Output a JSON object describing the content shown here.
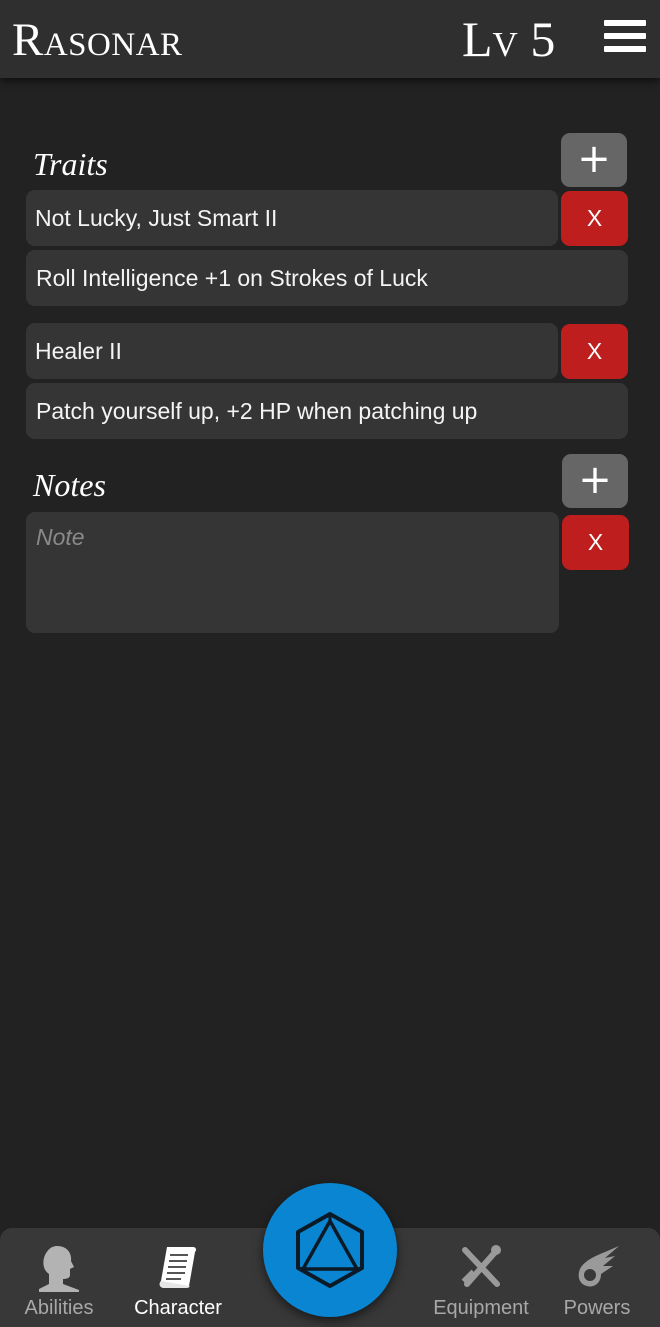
{
  "header": {
    "character_name": "Rasonar",
    "level": "Lv 5",
    "menu_icon": "hamburger-menu-icon"
  },
  "traits": {
    "title": "Traits",
    "add_label": "+",
    "items": [
      {
        "name": "Not Lucky, Just Smart II",
        "description": "Roll Intelligence +1 on Strokes of Luck",
        "remove_label": "X"
      },
      {
        "name": "Healer II",
        "description": "Patch yourself up, +2 HP when patching up",
        "remove_label": "X"
      }
    ]
  },
  "notes": {
    "title": "Notes",
    "add_label": "+",
    "items": [
      {
        "value": "",
        "placeholder": "Note",
        "remove_label": "X"
      }
    ]
  },
  "bottom_nav": {
    "items": [
      {
        "label": "Abilities",
        "icon": "head-silhouette-icon",
        "active": false
      },
      {
        "label": "Character",
        "icon": "scroll-icon",
        "active": true
      },
      {
        "label": "Equipment",
        "icon": "crossed-weapons-icon",
        "active": false
      },
      {
        "label": "Powers",
        "icon": "fireball-icon",
        "active": false
      }
    ],
    "center_button_icon": "d20-dice-icon"
  },
  "colors": {
    "background": "#222222",
    "topbar": "#2f2f2f",
    "row": "#353535",
    "add_button": "#666666",
    "remove_button": "#bf1e1e",
    "accent_blue": "#0a85d1",
    "nav_bar": "#383838"
  }
}
